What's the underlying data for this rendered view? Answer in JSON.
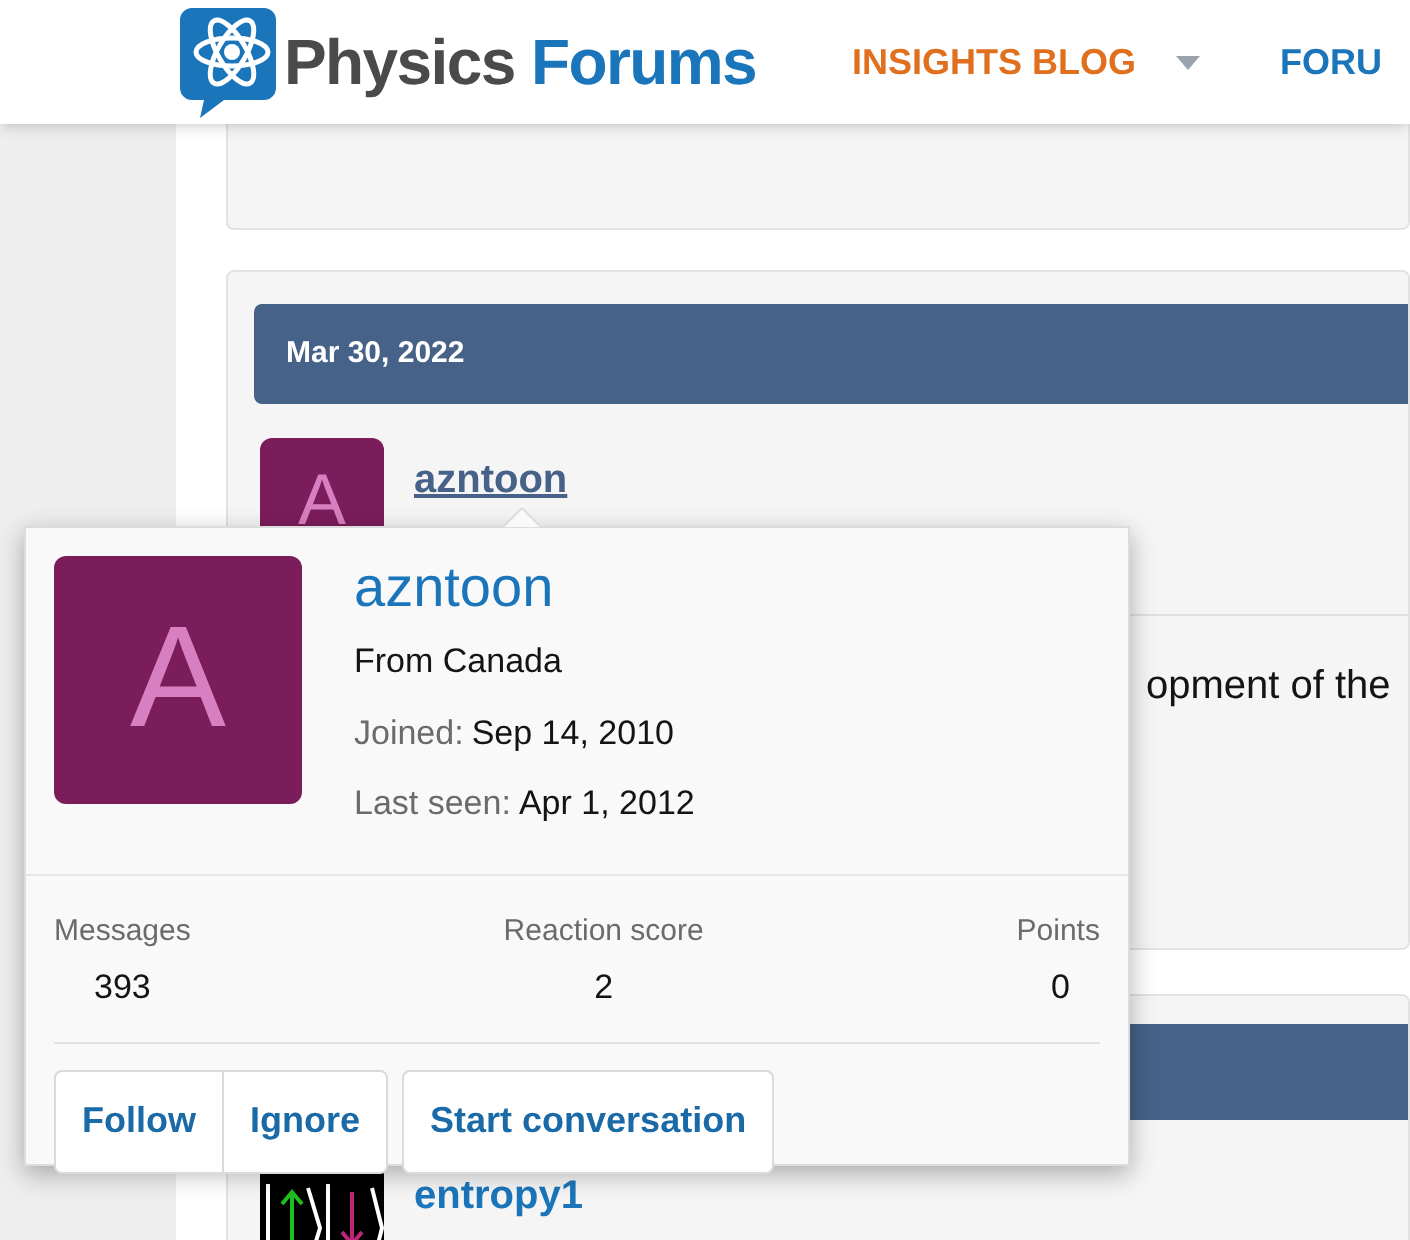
{
  "header": {
    "logo": {
      "word_1": "Physics",
      "word_2": "Forums"
    },
    "nav": [
      {
        "label": "INSIGHTS BLOG",
        "selected": true,
        "has_menu": true
      },
      {
        "label": "FORU",
        "selected": false,
        "has_menu": false
      }
    ]
  },
  "posts": [
    {
      "date": "Mar 30, 2022",
      "avatar_letter": "A",
      "username": "azntoon",
      "text": "opment of the"
    },
    {
      "username": "entropy1"
    }
  ],
  "profile_card": {
    "avatar_letter": "A",
    "username": "azntoon",
    "location": "From Canada",
    "joined_label": "Joined:",
    "joined": "Sep 14, 2010",
    "last_seen_label": "Last seen:",
    "last_seen": "Apr 1, 2012",
    "stats": [
      {
        "label": "Messages",
        "value": "393"
      },
      {
        "label": "Reaction score",
        "value": "2"
      },
      {
        "label": "Points",
        "value": "0"
      }
    ],
    "buttons": [
      "Follow",
      "Ignore",
      "Start conversation"
    ]
  }
}
